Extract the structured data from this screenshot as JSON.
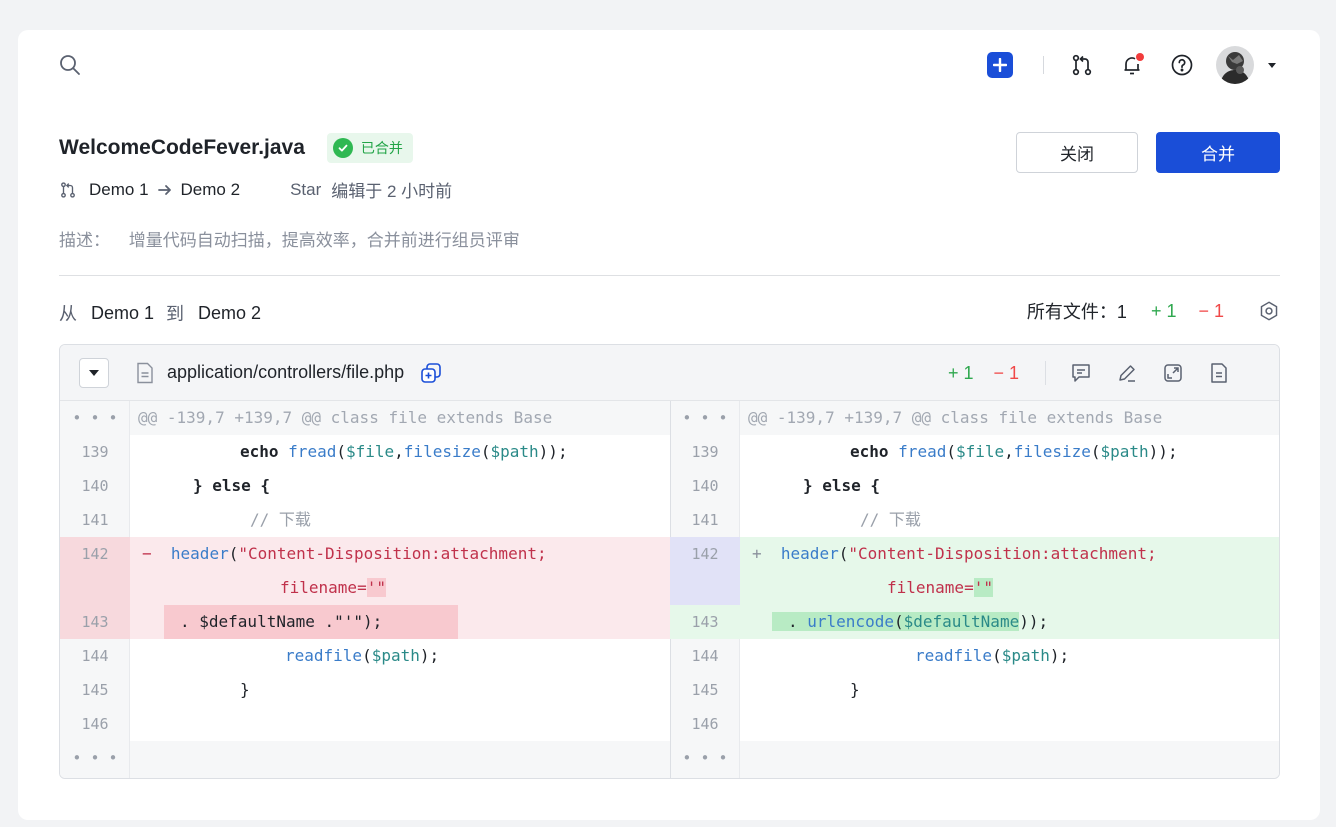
{
  "topbar": {
    "search_icon": "search-icon",
    "icons": [
      "plus-icon",
      "merge-request-icon",
      "bell-icon",
      "help-icon"
    ],
    "notification_dot": true
  },
  "header": {
    "title": "WelcomeCodeFever.java",
    "status_badge": "已合并",
    "source_branch": "Demo 1",
    "target_branch": "Demo 2",
    "author": "Star",
    "edited_text": "编辑于 2 小时前",
    "description_label": "描述：",
    "description": "增量代码自动扫描，提高效率，合并前进行组员评审",
    "close_label": "关闭",
    "merge_label": "合并"
  },
  "compare": {
    "from_label": "从",
    "from": "Demo 1",
    "to_label": "到",
    "to": "Demo 2",
    "files_label": "所有文件：1",
    "added": "+ 1",
    "removed": "− 1"
  },
  "file": {
    "path": "application/controllers/file.php",
    "added": "+ 1",
    "removed": "− 1",
    "hunk_header": "@@ -139,7 +139,7 @@ class file extends Base",
    "ellipsis": "• • •",
    "left_lines": [
      {
        "num": "139",
        "type": "ctx"
      },
      {
        "num": "140",
        "type": "ctx"
      },
      {
        "num": "141",
        "type": "ctx"
      },
      {
        "num": "142",
        "type": "del"
      },
      {
        "num": "",
        "type": "del"
      },
      {
        "num": "143",
        "type": "del"
      },
      {
        "num": "144",
        "type": "ctx"
      },
      {
        "num": "145",
        "type": "ctx"
      },
      {
        "num": "146",
        "type": "ctx"
      }
    ],
    "right_lines": [
      {
        "num": "139",
        "type": "ctx"
      },
      {
        "num": "140",
        "type": "ctx"
      },
      {
        "num": "141",
        "type": "ctx"
      },
      {
        "num": "142",
        "type": "add"
      },
      {
        "num": "",
        "type": "add"
      },
      {
        "num": "143",
        "type": "add"
      },
      {
        "num": "144",
        "type": "ctx"
      },
      {
        "num": "145",
        "type": "ctx"
      },
      {
        "num": "146",
        "type": "ctx"
      }
    ],
    "code": {
      "echo": "echo",
      "fread": "fread",
      "file_var": "$file",
      "filesize": "filesize",
      "path_var": "$path",
      "else_open": "} else {",
      "comment": "// 下载",
      "header_fn": "header",
      "header_str": "\"Content-Disposition:attachment;",
      "filename_str": "filename=",
      "quote_str": "'\"",
      "left_143": ". $defaultName .\"'\");",
      "right_143_pre": ". ",
      "urlencode": "urlencode",
      "default_name": "$defaultName",
      "right_143_post": "));",
      "readfile": "readfile",
      "close_brace": "}",
      "minus": "−",
      "plus": "+"
    }
  },
  "colors": {
    "primary": "#1a4ed8",
    "added": "#2fa84f",
    "removed": "#f04848",
    "del_bg": "#fbe9ec",
    "add_bg": "#e6f8ea",
    "del_gutter": "#f7d9dd",
    "add_gutter_left": "#e1e2f7"
  }
}
